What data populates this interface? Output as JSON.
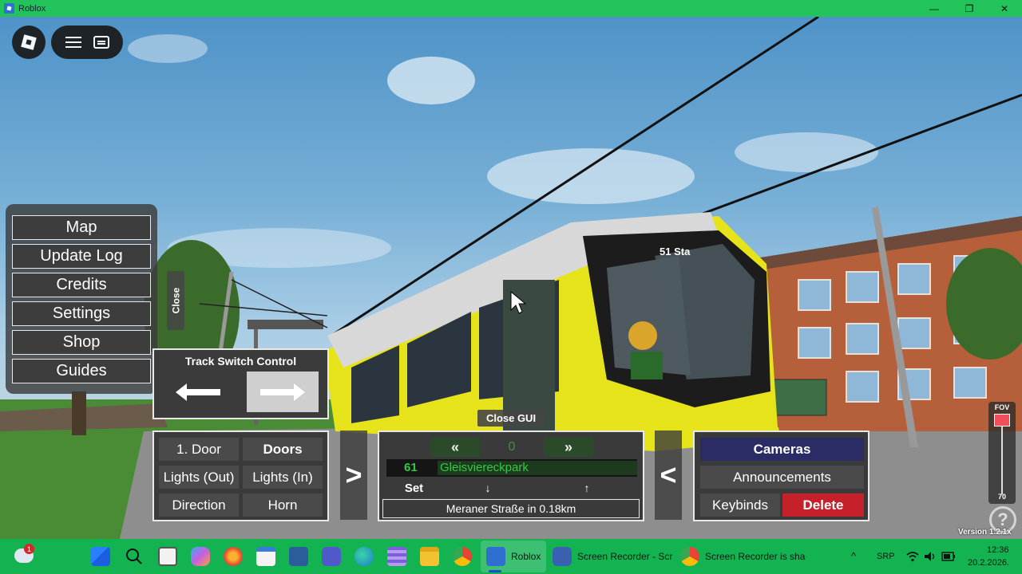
{
  "window": {
    "title": "Roblox",
    "minimize": "—",
    "maximize": "❐",
    "close": "✕"
  },
  "left_menu": {
    "items": [
      "Map",
      "Update Log",
      "Credits",
      "Settings",
      "Shop",
      "Guides"
    ],
    "close_label": "Close"
  },
  "track_switch": {
    "title": "Track Switch Control",
    "left_icon": "arrow-left-icon",
    "right_icon": "arrow-right-icon"
  },
  "door_panel": {
    "buttons": [
      "1. Door",
      "Doors",
      "Lights (Out)",
      "Lights (In)",
      "Direction",
      "Horn"
    ]
  },
  "next_arrow": ">",
  "prev_arrow": "<",
  "destination_panel": {
    "prev": "«",
    "index": "0",
    "next": "»",
    "line": "61",
    "destination": "Gleisviereckpark",
    "set_label": "Set",
    "down": "↓",
    "up": "↑",
    "next_stop": "Meraner Straße in 0.18km"
  },
  "close_gui": "Close GUI",
  "camera_panel": {
    "cameras": "Cameras",
    "announcements": "Announcements",
    "keybinds": "Keybinds",
    "delete": "Delete"
  },
  "fov": {
    "label": "FOV",
    "value": "70",
    "level": 1.0
  },
  "help": "?",
  "version": "Version 1.2.1x",
  "tram_sign": "51 Sta",
  "colors": {
    "titlebar": "#21c35a",
    "taskbar": "#13b352",
    "cameras_bg": "#2b2b66",
    "delete_bg": "#c6202a",
    "dest_text": "#2ecc40",
    "tram_yellow": "#e6e31a"
  },
  "taskbar": {
    "notification_badge": "1",
    "apps": [
      {
        "icon": "windows-start-icon"
      },
      {
        "icon": "search-icon"
      },
      {
        "icon": "file-icon"
      },
      {
        "icon": "copilot-icon"
      },
      {
        "icon": "firefox-icon"
      },
      {
        "icon": "store-icon"
      },
      {
        "icon": "terminal-icon"
      },
      {
        "icon": "teams-icon"
      },
      {
        "icon": "edge-icon"
      },
      {
        "icon": "app-icon"
      },
      {
        "icon": "folder-icon"
      },
      {
        "icon": "chrome-icon"
      }
    ],
    "running": [
      {
        "icon": "roblox-icon",
        "label": "Roblox"
      },
      {
        "icon": "recorder-icon",
        "label": "Screen Recorder - Scr"
      },
      {
        "icon": "chrome-icon",
        "label": "Screen Recorder is sha"
      }
    ],
    "tray": {
      "chevron": "^",
      "language": "SRP",
      "time": "12:36",
      "date": "20.2.2026."
    }
  }
}
